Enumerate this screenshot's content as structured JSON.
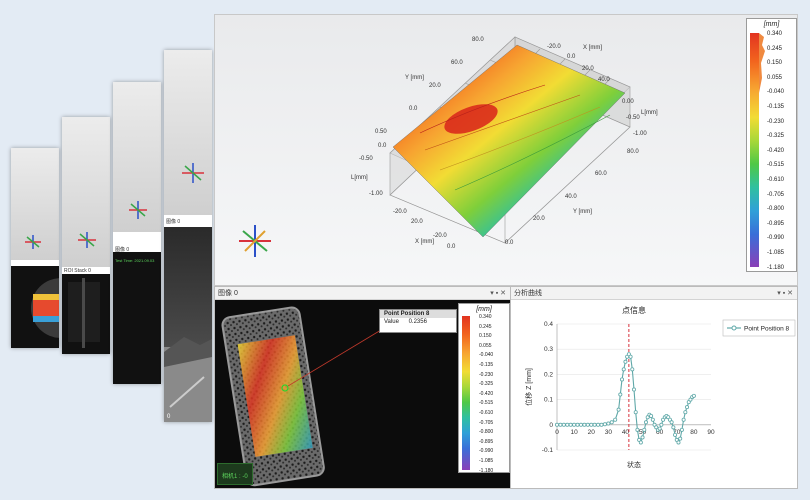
{
  "thumb_cards": [
    {
      "caption": ""
    },
    {
      "caption": "ROI Stack 0"
    },
    {
      "caption": "图像 0",
      "status": "Test Time: 2021.09.03"
    },
    {
      "caption": "图像 0",
      "zero": "0"
    },
    {
      "caption": "图像 0",
      "zero": "0"
    }
  ],
  "main_view": {
    "axes": {
      "x_label": "X [mm]",
      "y_label": "Y [mm]",
      "l_label": "L[mm]",
      "x_ticks": [
        "-20.0",
        "0.0",
        "20.0",
        "40.0",
        "60.0",
        "80.0"
      ],
      "y_ticks": [
        "20.0",
        "0.0",
        "-20.0",
        "-40.0",
        "60.0"
      ],
      "l_ticks_left": [
        "0.50",
        "0.0",
        "-0.50",
        "-1.00"
      ],
      "l_ticks_right": [
        "0.00",
        "-0.50",
        "-1.00"
      ],
      "top_ticks": [
        "80.0",
        "60.0",
        "40.0",
        "20.0",
        "0.0",
        "-20.0"
      ]
    },
    "colorbar": {
      "title": "[mm]",
      "ticks": [
        "0.340",
        "0.245",
        "0.150",
        "0.055",
        "-0.040",
        "-0.135",
        "-0.230",
        "-0.325",
        "-0.420",
        "-0.515",
        "-0.610",
        "-0.705",
        "-0.800",
        "-0.895",
        "-0.990",
        "-1.085",
        "-1.180"
      ]
    }
  },
  "image_pane": {
    "title": "图像 0",
    "header_buttons": "▾ ▪ ✕",
    "tooltip_title": "Point Position 8",
    "tooltip_key": "Value",
    "tooltip_value": "0.2356",
    "status": "相机1 : -0",
    "colorbar": {
      "title": "[mm]",
      "ticks": [
        "0.340",
        "0.245",
        "0.150",
        "0.055",
        "-0.040",
        "-0.135",
        "-0.230",
        "-0.325",
        "-0.420",
        "-0.515",
        "-0.610",
        "-0.705",
        "-0.800",
        "-0.895",
        "-0.990",
        "-1.085",
        "-1.180"
      ]
    }
  },
  "analysis_pane": {
    "title": "分析曲线",
    "header_buttons": "▾ ▪ ✕"
  },
  "chart_data": {
    "type": "line",
    "title": "点信息",
    "xlabel": "状态",
    "ylabel": "位移 Z [mm]",
    "xlim": [
      0,
      90
    ],
    "ylim": [
      -0.1,
      0.4
    ],
    "x_ticks": [
      0,
      10,
      20,
      30,
      40,
      50,
      60,
      70,
      80,
      90
    ],
    "y_ticks": [
      -0.1,
      0,
      0.1,
      0.2,
      0.3,
      0.4
    ],
    "legend_position": "top-right",
    "marker_x": 42,
    "series": [
      {
        "name": "Point Position 8",
        "color": "#5fa8a8",
        "x": [
          0,
          2,
          4,
          6,
          8,
          10,
          12,
          14,
          16,
          18,
          20,
          22,
          24,
          26,
          28,
          30,
          32,
          34,
          36,
          37,
          38,
          39,
          40,
          41,
          42,
          43,
          44,
          45,
          46,
          47,
          48,
          49,
          50,
          51,
          52,
          53,
          54,
          55,
          56,
          57,
          58,
          59,
          60,
          61,
          62,
          63,
          64,
          65,
          66,
          67,
          68,
          69,
          70,
          71,
          72,
          73,
          74,
          75,
          76,
          77,
          78,
          79,
          80
        ],
        "y": [
          0,
          0,
          0,
          0,
          0,
          0,
          0,
          0,
          0,
          0,
          0,
          0,
          0,
          0,
          0.002,
          0.005,
          0.01,
          0.02,
          0.06,
          0.12,
          0.18,
          0.22,
          0.25,
          0.27,
          0.28,
          0.27,
          0.22,
          0.14,
          0.05,
          -0.02,
          -0.06,
          -0.07,
          -0.05,
          -0.02,
          0.01,
          0.03,
          0.04,
          0.035,
          0.02,
          0,
          -0.01,
          -0.02,
          -0.015,
          0,
          0.02,
          0.03,
          0.035,
          0.03,
          0.02,
          0.01,
          -0.01,
          -0.04,
          -0.06,
          -0.07,
          -0.055,
          -0.02,
          0.02,
          0.05,
          0.07,
          0.09,
          0.1,
          0.11,
          0.115
        ]
      }
    ]
  }
}
